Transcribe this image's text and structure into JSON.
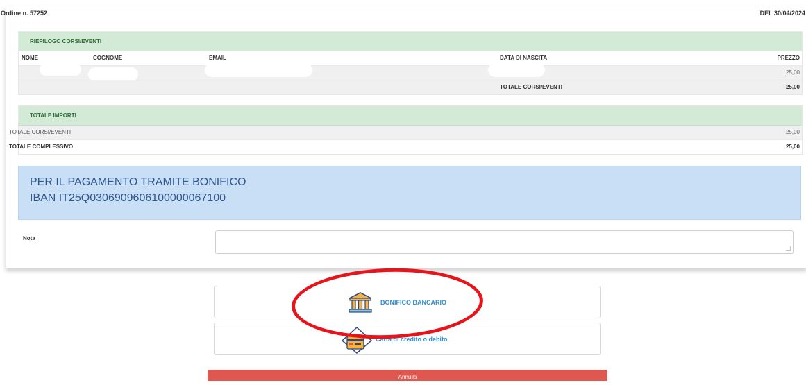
{
  "order": {
    "number_label": "Ordine n. 57252",
    "date_label": "DEL 30/04/2024"
  },
  "summary": {
    "title": "RIEPILOGO CORSI/EVENTI",
    "columns": {
      "name": "NOME",
      "surname": "COGNOME",
      "email": "EMAIL",
      "birth_date": "DATA DI NASCITA",
      "price": "PREZZO"
    },
    "row_price": "25,00",
    "total_label": "TOTALE CORSI/EVENTI",
    "total_value": "25,00"
  },
  "totals": {
    "title": "TOTALE IMPORTI",
    "rows": [
      {
        "label": "TOTALE CORSI/EVENTI",
        "value": "25,00"
      },
      {
        "label": "TOTALE COMPLESSIVO",
        "value": "25,00"
      }
    ]
  },
  "payment_info": {
    "line1": "PER IL PAGAMENTO TRAMITE BONIFICO",
    "line2": "IBAN  IT25Q0306909606100000067100"
  },
  "note": {
    "label": "Nota",
    "value": ""
  },
  "payment_options": {
    "bank_transfer_label": "BONIFICO BANCARIO",
    "card_label": "Carta di credito o debito"
  },
  "cancel_label": "Annulla",
  "colors": {
    "section_header": "#d2ead6",
    "info_box": "#c9dff5",
    "accent_link": "#2e8fd6",
    "cancel_button": "#e0574f",
    "highlight": "#e8141b"
  }
}
